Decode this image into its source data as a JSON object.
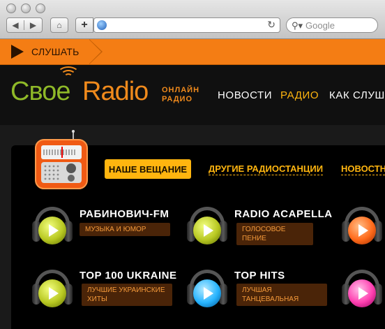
{
  "browser": {
    "search_placeholder": "Google",
    "back_icon": "back-arrow-icon",
    "forward_icon": "forward-arrow-icon",
    "home_icon": "home-icon",
    "add_icon": "plus-icon",
    "reload_icon": "reload-icon"
  },
  "listen_bar": {
    "label": "СЛУШАТЬ",
    "color": "#f47d14"
  },
  "logo": {
    "part1": "Свое",
    "part2": "Radio",
    "tagline_line1": "ОНЛАЙН",
    "tagline_line2": "РАДИО"
  },
  "nav": [
    {
      "label": "НОВОСТИ",
      "active": false
    },
    {
      "label": "РАДИО",
      "active": true
    },
    {
      "label": "КАК СЛУШ",
      "active": false
    }
  ],
  "tabs": [
    {
      "label": "НАШЕ ВЕЩАНИЕ",
      "active": true
    },
    {
      "label": "ДРУГИЕ РАДИОСТАНЦИИ",
      "active": false
    },
    {
      "label": "НОВОСТНЫ",
      "active": false
    }
  ],
  "stations": [
    {
      "name": "РАБИНОВИЧ-FM",
      "tag": "МУЗЫКА И ЮМОР",
      "color": "#b8c822"
    },
    {
      "name": "RADIO ACAPELLA",
      "tag": "ГОЛОСОВОЕ ПЕНИЕ",
      "color": "#b8c822"
    },
    {
      "name": "",
      "tag": "",
      "color": "#ff6a1a"
    },
    {
      "name": "TOP 100 UKRAINE",
      "tag": "ЛУЧШИЕ УКРАИНСКИЕ ХИТЫ",
      "color": "#b8c822"
    },
    {
      "name": "TOP HITS",
      "tag": "ЛУЧШАЯ ТАНЦЕВАЛЬНАЯ",
      "color": "#27b4ff"
    },
    {
      "name": "",
      "tag": "",
      "color": "#ff3fb0"
    }
  ]
}
